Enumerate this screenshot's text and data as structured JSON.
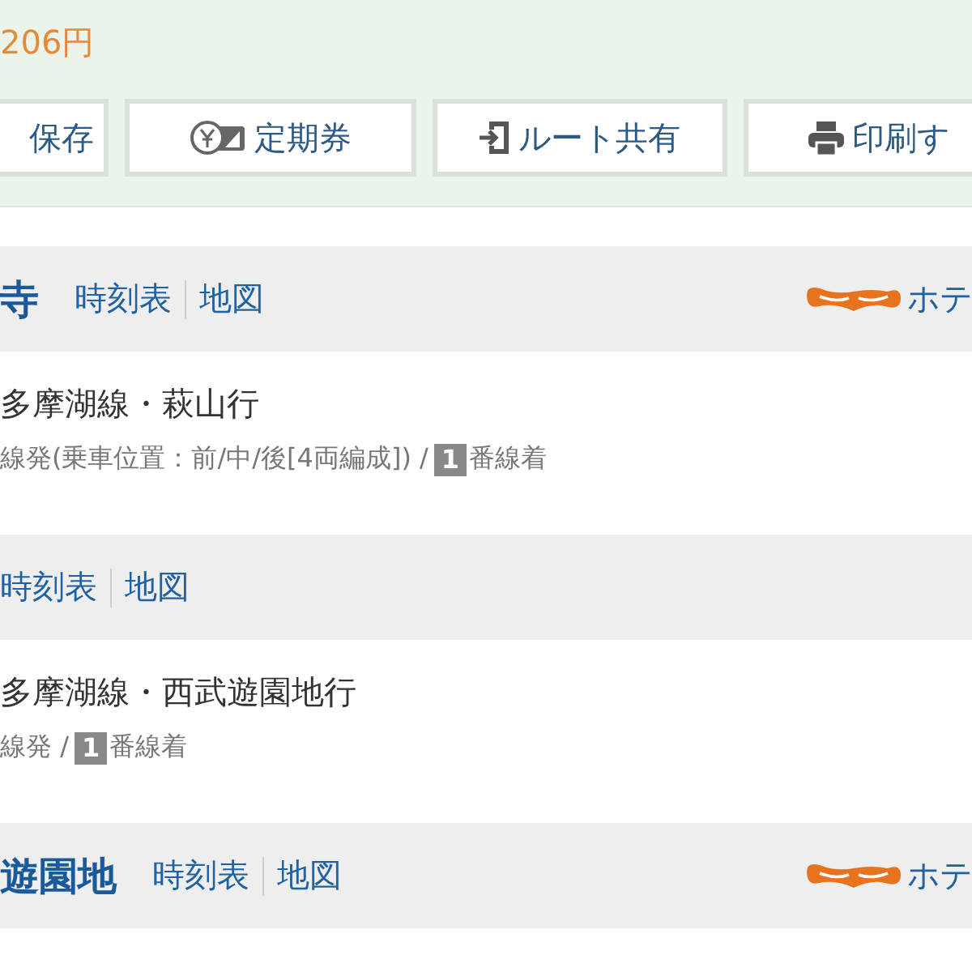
{
  "fare": "206円",
  "actions": [
    {
      "label": "保存",
      "kind": "plain"
    },
    {
      "label": "定期券",
      "kind": "pass"
    },
    {
      "label": "ルート共有",
      "kind": "share"
    },
    {
      "label": "印刷す",
      "kind": "print"
    }
  ],
  "route": [
    {
      "kind": "station",
      "tail": "寺",
      "links": [
        "時刻表",
        "地図"
      ],
      "hotel": "ホテ"
    },
    {
      "kind": "ride",
      "line": "多摩湖線・萩山行",
      "detail": "線発(乗車位置：前/中/後[4両編成]) / ",
      "track": "1",
      "arrival": "番線着"
    },
    {
      "kind": "station",
      "links": [
        "時刻表",
        "地図"
      ]
    },
    {
      "kind": "ride",
      "line": "多摩湖線・西武遊園地行",
      "detail": "線発 / ",
      "track": "1",
      "arrival": "番線着"
    },
    {
      "kind": "station",
      "tail": "遊園地",
      "links": [
        "時刻表",
        "地図"
      ],
      "hotel": "ホテ"
    }
  ]
}
